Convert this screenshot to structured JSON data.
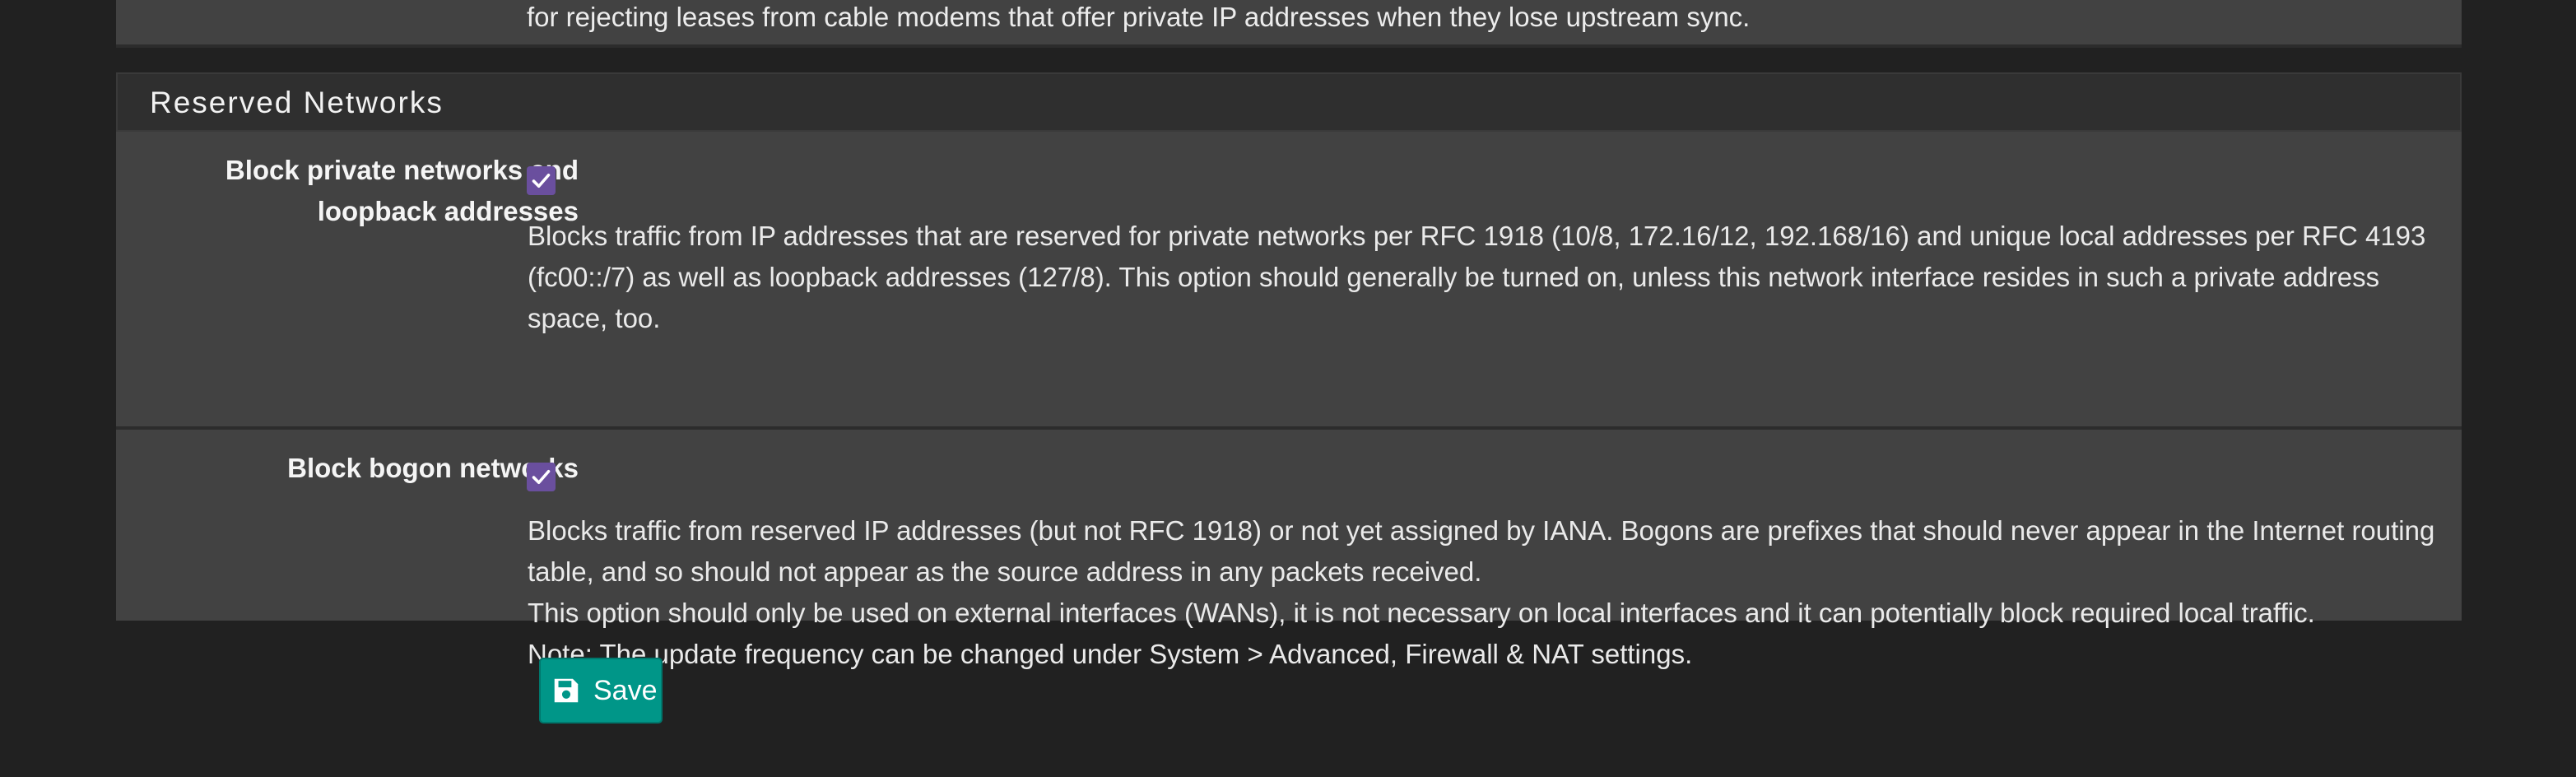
{
  "previous_section": {
    "help_tail": "for rejecting leases from cable modems that offer private IP addresses when they lose upstream sync."
  },
  "reserved_networks": {
    "title": "Reserved Networks",
    "block_private": {
      "label": "Block private networks and loopback addresses",
      "checked": true,
      "help": "Blocks traffic from IP addresses that are reserved for private networks per RFC 1918 (10/8, 172.16/12, 192.168/16) and unique local addresses per RFC 4193 (fc00::/7) as well as loopback addresses (127/8). This option should generally be turned on, unless this network interface resides in such a private address space, too."
    },
    "block_bogon": {
      "label": "Block bogon networks",
      "checked": true,
      "help_line1": "Blocks traffic from reserved IP addresses (but not RFC 1918) or not yet assigned by IANA. Bogons are prefixes that should never appear in the Internet routing table, and so should not appear as the source address in any packets received.",
      "help_line2": "This option should only be used on external interfaces (WANs), it is not necessary on local interfaces and it can potentially block required local traffic.",
      "help_line3": "Note: The update frequency can be changed under System > Advanced, Firewall & NAT settings."
    }
  },
  "actions": {
    "save_label": "Save",
    "save_icon": "floppy-disk-icon"
  },
  "colors": {
    "page_bg": "#212121",
    "panel_bg": "#424242",
    "heading_bg": "#2f2f2f",
    "checkbox": "#6a4f9e",
    "save_button": "#009688"
  }
}
